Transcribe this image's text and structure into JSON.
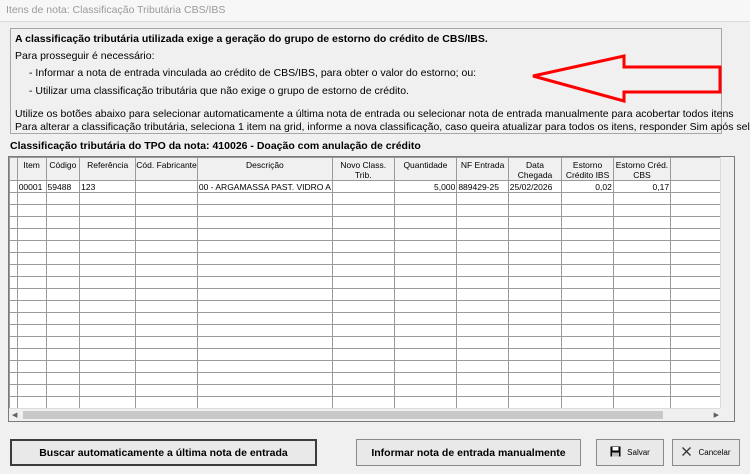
{
  "window": {
    "title": "Itens de nota: Classificação Tributária CBS/IBS"
  },
  "info": {
    "heading": "A classificação tributária utilizada exige a geração do grupo de estorno do crédito de CBS/IBS.",
    "intro": "Para prosseguir é necessário:",
    "option1": "- Informar a nota de entrada vinculada ao crédito de CBS/IBS, para obter o valor do estorno; ou:",
    "option2": "- Utilizar uma classificação tributária que não exige o grupo de estorno de crédito.",
    "hint1": "Utilize os botões abaixo para selecionar automaticamente a última nota de entrada ou selecionar nota de entrada manualmente para acobertar todos itens",
    "hint2": "Para alterar a classificação tributária, seleciona 1 item na grid, informe a nova classificação, caso queira atualizar para todos os itens, responder Sim após selecionar."
  },
  "section": {
    "title": "Classificação tributária do TPO da nota: 410026 - Doação com anulação de crédito"
  },
  "grid": {
    "columns": [
      "Item",
      "Código",
      "Referência",
      "Cód. Fabricante",
      "Descrição",
      "Novo Class. Trib.",
      "Quantidade",
      "NF Entrada",
      "Data Chegada",
      "Estorno Crédito IBS",
      "Estorno Créd. CBS"
    ],
    "rows": [
      [
        "00001",
        "59488",
        "123",
        "",
        "00 - ARGAMASSA PAST. VIDRO A",
        "",
        "5,000",
        "889429-25",
        "25/02/2026",
        "0,02",
        "0,17"
      ]
    ]
  },
  "buttons": {
    "auto": "Buscar automaticamente a última nota de entrada",
    "manual": "Informar nota de entrada manualmente",
    "save": "Salvar",
    "cancel": "Cancelar"
  },
  "colors": {
    "arrow": "#ff0000",
    "header": "#f0f0f0",
    "border": "#9a9a9a"
  }
}
